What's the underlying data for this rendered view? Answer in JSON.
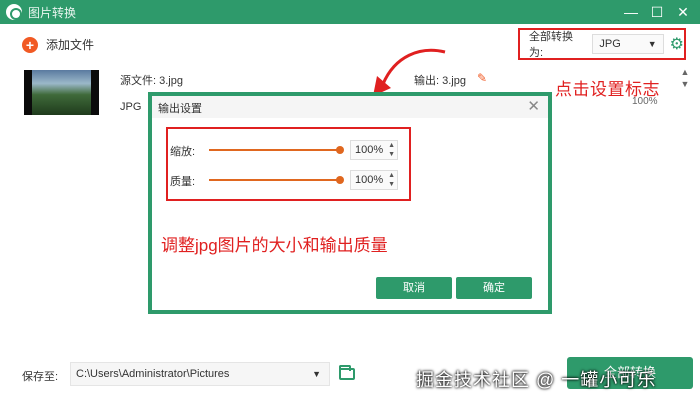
{
  "window": {
    "title": "图片转换",
    "controls": [
      "minimize-icon",
      "maximize-icon",
      "close-icon"
    ]
  },
  "toolbar": {
    "add_file_label": "添加文件",
    "convert_all_label": "全部转换为:",
    "convert_all_value": "JPG",
    "settings_icon": "gear-icon"
  },
  "file_item": {
    "source_label": "源文件: 3.jpg",
    "format_label": "JPG",
    "output_label": "输出: 3.jpg",
    "percent_label": "100%"
  },
  "annotations": {
    "top": "点击设置标志",
    "middle": "调整jpg图片的大小和输出质量"
  },
  "dialog": {
    "title": "输出设置",
    "settings": [
      {
        "label": "缩放:",
        "value": "100%",
        "level": 1.0
      },
      {
        "label": "质量:",
        "value": "100%",
        "level": 1.0
      }
    ],
    "cancel_label": "取消",
    "ok_label": "确定"
  },
  "footer": {
    "save_label": "保存至:",
    "path_value": "C:\\Users\\Administrator\\Pictures",
    "convert_label": "全部转换"
  },
  "watermark": "掘金技术社区 @ 一罐小可乐",
  "colors": {
    "brand": "#2e9a6b",
    "accent": "#f15a24",
    "annotation": "#e02020",
    "slider": "#e0671f"
  }
}
